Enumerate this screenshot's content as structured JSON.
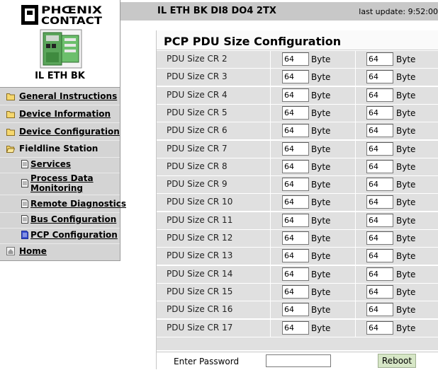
{
  "brand": {
    "logo_text": [
      "PHŒNIX",
      "CONTACT"
    ],
    "device_name": "IL ETH BK"
  },
  "sidebar": {
    "items": [
      {
        "label": "General Instructions"
      },
      {
        "label": "Device Information"
      },
      {
        "label": "Device Configuration"
      },
      {
        "label": "Fieldline Station"
      },
      {
        "label": "Services"
      },
      {
        "label": "Process Data Monitoring"
      },
      {
        "label": "Remote Diagnostics"
      },
      {
        "label": "Bus Configuration"
      },
      {
        "label": "PCP Configuration"
      },
      {
        "label": "Home"
      }
    ]
  },
  "header": {
    "title": "IL ETH BK DI8 DO4 2TX",
    "last_update": "last update: 9:52:00"
  },
  "main": {
    "title": "PCP PDU Size Configuration",
    "rows": [
      {
        "name": "PDU Size CR 2",
        "v1": "64",
        "u1": "Byte",
        "v2": "64",
        "u2": "Byte"
      },
      {
        "name": "PDU Size CR 3",
        "v1": "64",
        "u1": "Byte",
        "v2": "64",
        "u2": "Byte"
      },
      {
        "name": "PDU Size CR 4",
        "v1": "64",
        "u1": "Byte",
        "v2": "64",
        "u2": "Byte"
      },
      {
        "name": "PDU Size CR 5",
        "v1": "64",
        "u1": "Byte",
        "v2": "64",
        "u2": "Byte"
      },
      {
        "name": "PDU Size CR 6",
        "v1": "64",
        "u1": "Byte",
        "v2": "64",
        "u2": "Byte"
      },
      {
        "name": "PDU Size CR 7",
        "v1": "64",
        "u1": "Byte",
        "v2": "64",
        "u2": "Byte"
      },
      {
        "name": "PDU Size CR 8",
        "v1": "64",
        "u1": "Byte",
        "v2": "64",
        "u2": "Byte"
      },
      {
        "name": "PDU Size CR 9",
        "v1": "64",
        "u1": "Byte",
        "v2": "64",
        "u2": "Byte"
      },
      {
        "name": "PDU Size CR 10",
        "v1": "64",
        "u1": "Byte",
        "v2": "64",
        "u2": "Byte"
      },
      {
        "name": "PDU Size CR 11",
        "v1": "64",
        "u1": "Byte",
        "v2": "64",
        "u2": "Byte"
      },
      {
        "name": "PDU Size CR 12",
        "v1": "64",
        "u1": "Byte",
        "v2": "64",
        "u2": "Byte"
      },
      {
        "name": "PDU Size CR 13",
        "v1": "64",
        "u1": "Byte",
        "v2": "64",
        "u2": "Byte"
      },
      {
        "name": "PDU Size CR 14",
        "v1": "64",
        "u1": "Byte",
        "v2": "64",
        "u2": "Byte"
      },
      {
        "name": "PDU Size CR 15",
        "v1": "64",
        "u1": "Byte",
        "v2": "64",
        "u2": "Byte"
      },
      {
        "name": "PDU Size CR 16",
        "v1": "64",
        "u1": "Byte",
        "v2": "64",
        "u2": "Byte"
      },
      {
        "name": "PDU Size CR 17",
        "v1": "64",
        "u1": "Byte",
        "v2": "64",
        "u2": "Byte"
      }
    ],
    "footer": {
      "password_label": "Enter Password",
      "password_value": "",
      "reboot_label": "Reboot"
    }
  },
  "colors": {
    "sidebar_bg": "#d4d4d4",
    "row_bg": "#e0e0e0",
    "button_bg": "#d6e6c6",
    "header_bg": "#c8c8c8"
  },
  "icons": {
    "folder": "folder-icon",
    "folder_open": "folder-open-icon",
    "page": "page-icon",
    "home": "home-icon"
  }
}
